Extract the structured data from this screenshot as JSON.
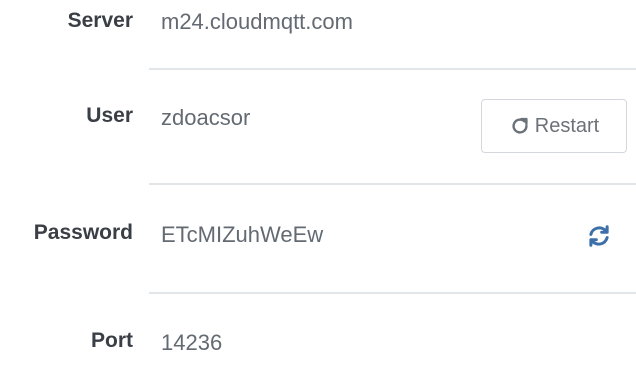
{
  "details": {
    "server": {
      "label": "Server",
      "value": "m24.cloudmqtt.com"
    },
    "user": {
      "label": "User",
      "value": "zdoacsor"
    },
    "password": {
      "label": "Password",
      "value": "ETcMIZuhWeEw"
    },
    "port": {
      "label": "Port",
      "value": "14236"
    },
    "restart_label": "Restart",
    "restart_icon": "restart-icon",
    "refresh_icon": "refresh-icon"
  },
  "colors": {
    "label": "#3a3f46",
    "value": "#636a72",
    "divider": "#e3e6e9",
    "refresh_icon": "#3d6fa8"
  }
}
